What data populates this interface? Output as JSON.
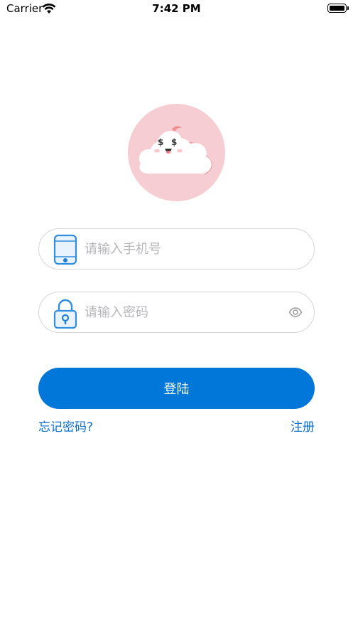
{
  "status_bar": {
    "carrier": "Carrier",
    "time": "7:42 PM",
    "icons": [
      "wifi-icon",
      "battery-icon"
    ]
  },
  "logo": {
    "icon": "cloud-mascot-icon",
    "background": "#f6cdd2"
  },
  "phone_field": {
    "placeholder": "请输入手机号",
    "value": "",
    "icon": "phone-icon"
  },
  "password_field": {
    "placeholder": "请输入密码",
    "value": "",
    "icon": "lock-icon",
    "toggle_icon": "eye-icon"
  },
  "login_button": {
    "label": "登陆",
    "color": "#0077d9"
  },
  "links": {
    "forgot_password": "忘记密码?",
    "register": "注册",
    "color": "#0a6fd0"
  }
}
